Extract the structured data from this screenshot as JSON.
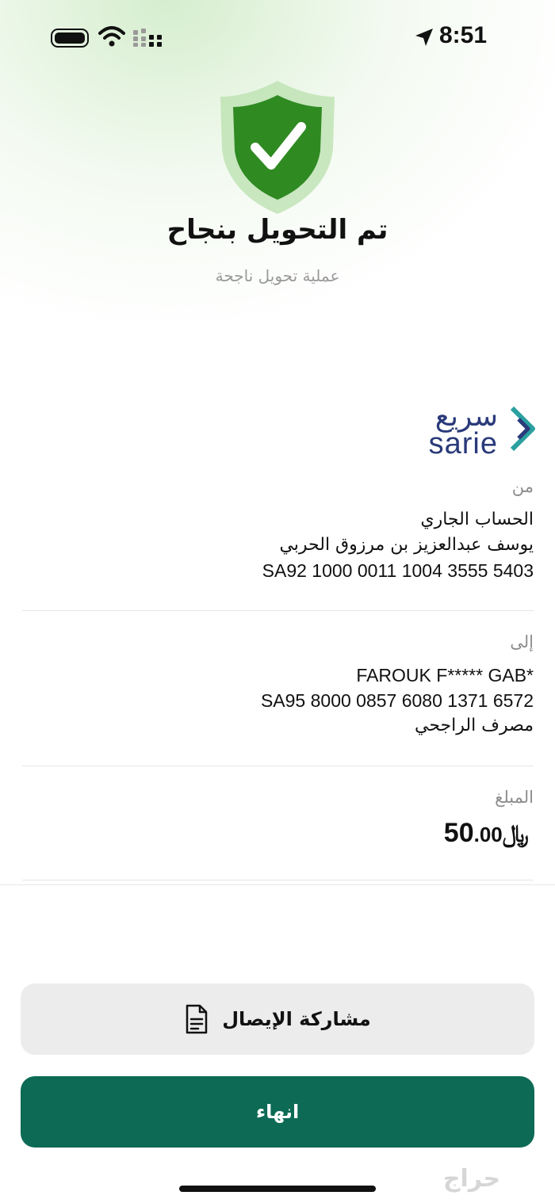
{
  "status_bar": {
    "time": "8:51"
  },
  "header": {
    "title": "تم التحويل بنجاح",
    "subtitle": "عملية تحويل ناجحة"
  },
  "logo": {
    "arabic": "سريع",
    "latin": "sarie"
  },
  "from": {
    "label": "من",
    "account_type": "الحساب الجاري",
    "name": "يوسف عبدالعزيز بن مرزوق الحربي",
    "iban": "SA92 1000 0011 1004 3555 5403"
  },
  "to": {
    "label": "إلى",
    "name": "FAROUK F***** GAB*",
    "iban": "SA95 8000 0857 6080 1371 6572",
    "bank": "مصرف الراجحي"
  },
  "amount": {
    "label": "المبلغ",
    "integer": "50",
    "decimal": ".00",
    "currency": "﷼"
  },
  "actions": {
    "share_label": "مشاركة الإيصال",
    "done_label": "انهاء"
  },
  "watermark": "حراج",
  "colors": {
    "primary": "#0c6a55",
    "shield_green": "#2f8a22",
    "logo_blue": "#2a3a7a"
  }
}
